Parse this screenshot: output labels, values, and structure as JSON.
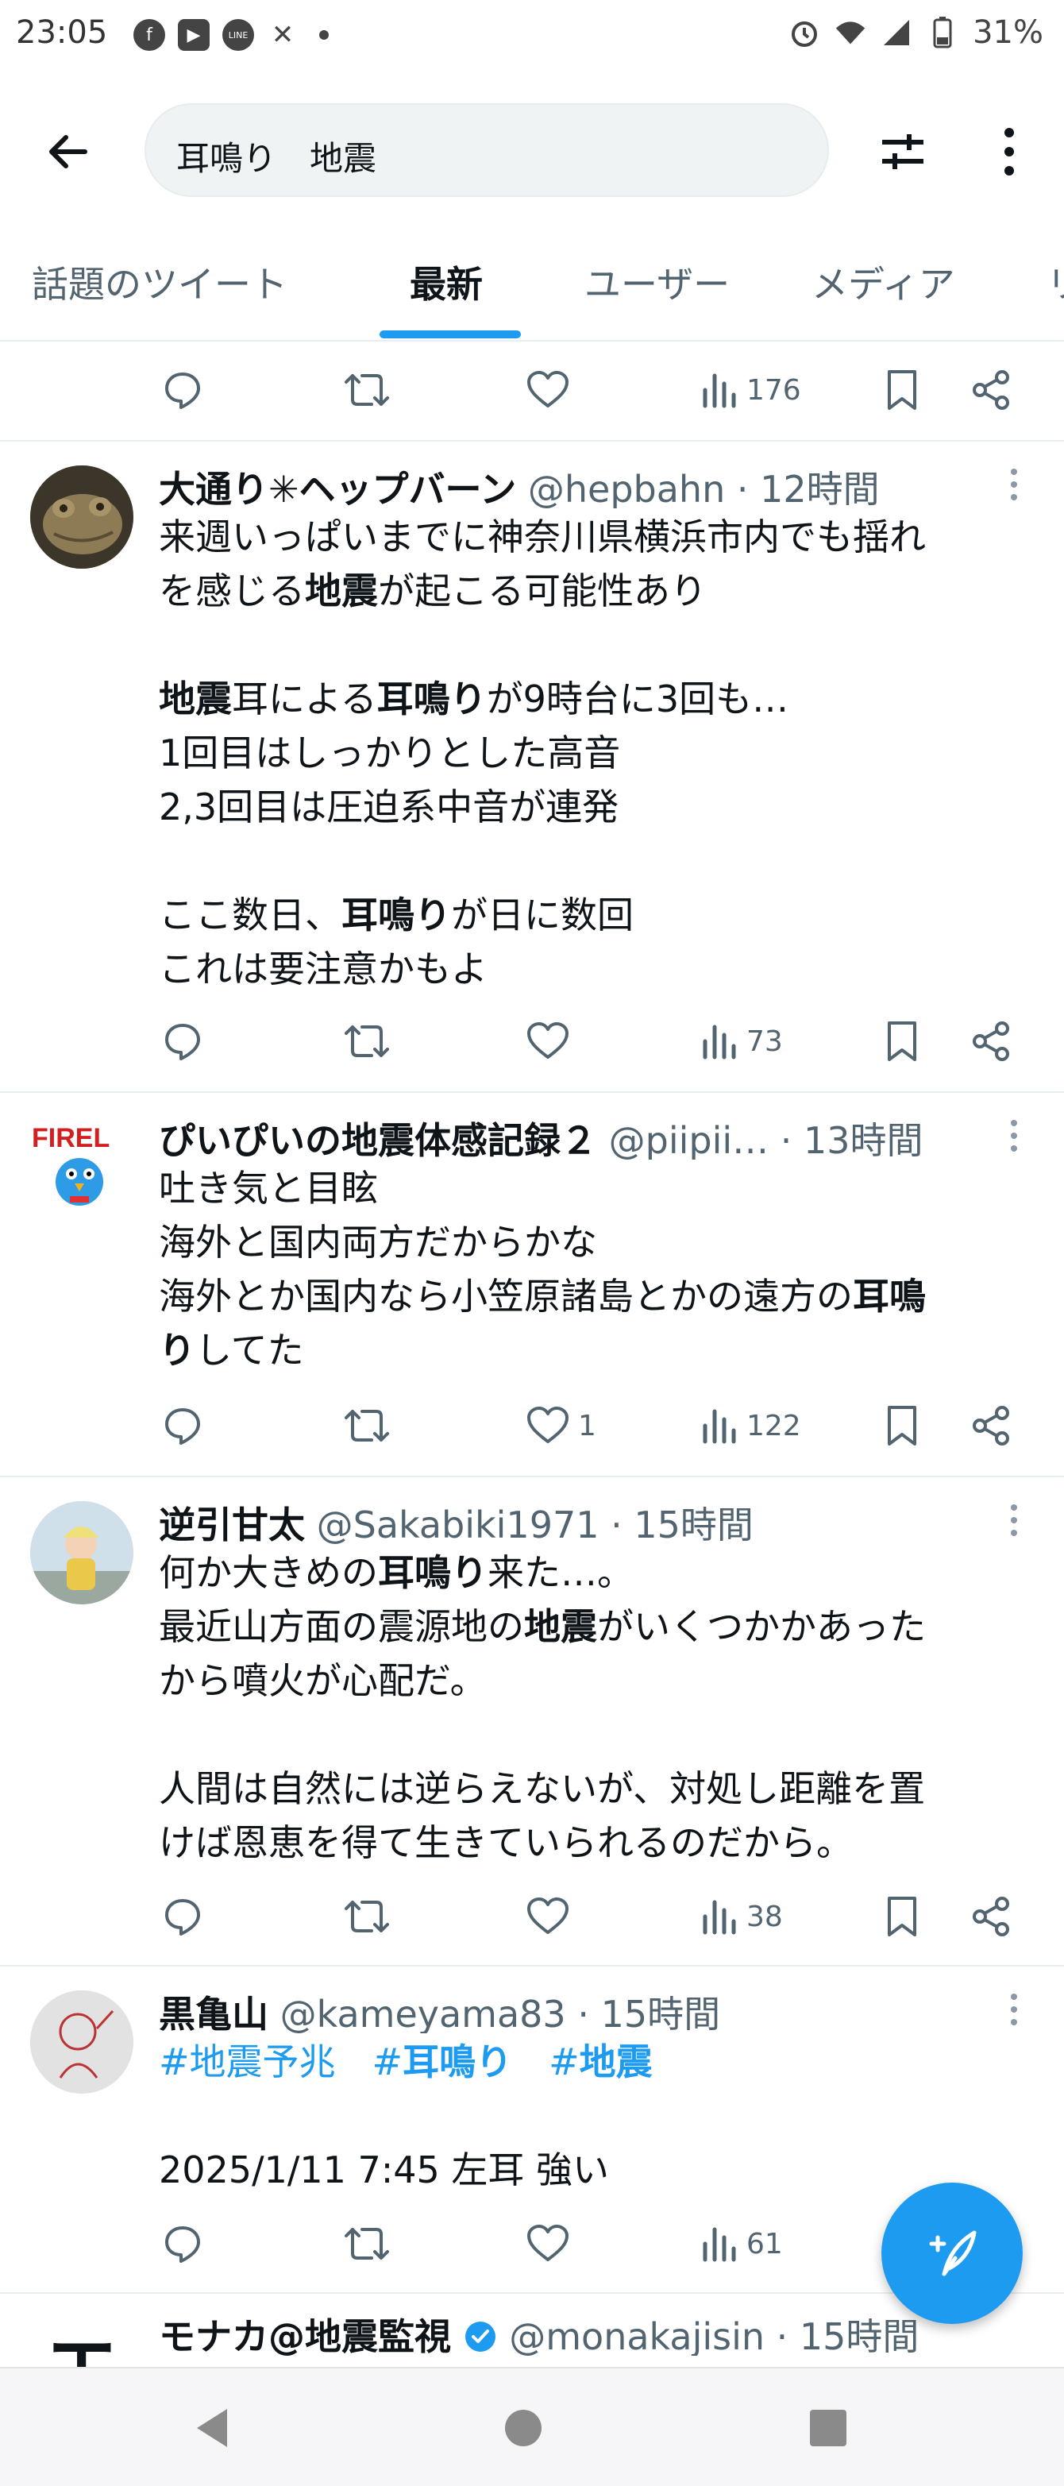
{
  "status_bar": {
    "time": "23:05",
    "battery": "31%",
    "apps": [
      "facebook-icon",
      "youtube-icon",
      "line-icon",
      "x-icon"
    ],
    "app_labels": [
      "f",
      "▶",
      "LINE",
      "✕"
    ]
  },
  "search": {
    "query": "耳鳴り　地震"
  },
  "tabs": [
    {
      "label": "話題のツイート"
    },
    {
      "label": "最新"
    },
    {
      "label": "ユーザー"
    },
    {
      "label": "メディア"
    },
    {
      "label": "リ"
    }
  ],
  "top_actions": {
    "views": "176"
  },
  "tweets": [
    {
      "name": "大通り✳ヘップバーン",
      "handle": "@hepbahn · 12時間",
      "lines": [
        [
          {
            "t": "来週いっぱいまでに神奈川県横浜市内でも揺れ"
          }
        ],
        [
          {
            "t": "を感じる"
          },
          {
            "t": "地震",
            "b": true
          },
          {
            "t": "が起こる可能性あり"
          }
        ],
        [],
        [
          {
            "t": "地震",
            "b": true
          },
          {
            "t": "耳による"
          },
          {
            "t": "耳鳴り",
            "b": true
          },
          {
            "t": "が9時台に3回も…"
          }
        ],
        [
          {
            "t": "1回目はしっかりとした高音"
          }
        ],
        [
          {
            "t": "2,3回目は圧迫系中音が連発"
          }
        ],
        [],
        [
          {
            "t": "ここ数日、"
          },
          {
            "t": "耳鳴り",
            "b": true
          },
          {
            "t": "が日に数回"
          }
        ],
        [
          {
            "t": "これは要注意かもよ"
          }
        ]
      ],
      "likes": "",
      "views": "73"
    },
    {
      "name": "ぴいぴいの地震体感記録２",
      "handle": "@piipii… · 13時間",
      "lines": [
        [
          {
            "t": "吐き気と目眩"
          }
        ],
        [
          {
            "t": "海外と国内両方だからかな"
          }
        ],
        [
          {
            "t": "海外とか国内なら小笠原諸島とかの遠方の"
          },
          {
            "t": "耳鳴",
            "b": true
          }
        ],
        [
          {
            "t": "り",
            "b": true
          },
          {
            "t": "してた"
          }
        ]
      ],
      "likes": "1",
      "views": "122"
    },
    {
      "name": "逆引甘太",
      "handle": "@Sakabiki1971 · 15時間",
      "lines": [
        [
          {
            "t": "何か大きめの"
          },
          {
            "t": "耳鳴り",
            "b": true
          },
          {
            "t": "来た…。"
          }
        ],
        [
          {
            "t": "最近山方面の震源地の"
          },
          {
            "t": "地震",
            "b": true
          },
          {
            "t": "がいくつかかあった"
          }
        ],
        [
          {
            "t": "から噴火が心配だ。"
          }
        ],
        [],
        [
          {
            "t": "人間は自然には逆らえないが、対処し距離を置"
          }
        ],
        [
          {
            "t": "けば恩恵を得て生きていられるのだから。"
          }
        ]
      ],
      "likes": "",
      "views": "38"
    },
    {
      "name": "黒亀山",
      "handle": "@kameyama83 · 15時間",
      "lines": [
        [
          {
            "t": "#地震予兆",
            "h": true
          },
          {
            "t": "　"
          },
          {
            "t": "#",
            "h": true
          },
          {
            "t": "耳鳴り",
            "h": true,
            "b": true
          },
          {
            "t": "　"
          },
          {
            "t": "#",
            "h": true
          },
          {
            "t": "地震",
            "h": true,
            "b": true
          }
        ],
        [],
        [
          {
            "t": "2025/1/11 7:45  左耳  強い"
          }
        ]
      ],
      "likes": "",
      "views": "61"
    },
    {
      "name": "モナカ@地震監視",
      "handle": "@monakajisin · 15時間",
      "lines": [],
      "likes": "",
      "views": ""
    }
  ],
  "avatar_texts": {
    "firel": "FIREL",
    "monaka": "エ"
  },
  "colors": {
    "accent": "#1d9bf0",
    "text": "#0f1419",
    "secondary": "#536471",
    "divider": "#e9eef1"
  },
  "icons": [
    "back-arrow-icon",
    "filter-icon",
    "more-vertical-icon",
    "reply-icon",
    "retweet-icon",
    "like-icon",
    "views-icon",
    "bookmark-icon",
    "share-icon",
    "compose-icon",
    "verified-icon",
    "nav-back-icon",
    "nav-home-icon",
    "nav-recents-icon"
  ]
}
